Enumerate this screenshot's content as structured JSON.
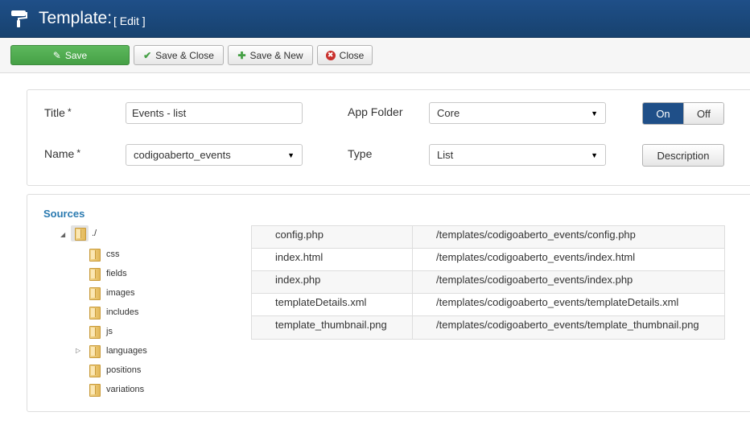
{
  "header": {
    "title": "Template:",
    "subtitle": "[ Edit ]",
    "icon": "paint-roller-icon"
  },
  "toolbar": {
    "save": "Save",
    "save_close": "Save & Close",
    "save_new": "Save & New",
    "close": "Close"
  },
  "form": {
    "title_label": "Title",
    "title_required": "*",
    "title_value": "Events - list",
    "name_label": "Name",
    "name_required": "*",
    "name_value": "codigoaberto_events",
    "app_folder_label": "App Folder",
    "app_folder_value": "Core",
    "type_label": "Type",
    "type_value": "List",
    "toggle_on": "On",
    "toggle_off": "Off",
    "description_button": "Description"
  },
  "sources": {
    "title": "Sources",
    "root": "./",
    "folders": [
      "css",
      "fields",
      "images",
      "includes",
      "js",
      "languages",
      "positions",
      "variations"
    ],
    "files": [
      {
        "name": "config.php",
        "path": "/templates/codigoaberto_events/config.php"
      },
      {
        "name": "index.html",
        "path": "/templates/codigoaberto_events/index.html"
      },
      {
        "name": "index.php",
        "path": "/templates/codigoaberto_events/index.php"
      },
      {
        "name": "templateDetails.xml",
        "path": "/templates/codigoaberto_events/templateDetails.xml"
      },
      {
        "name": "template_thumbnail.png",
        "path": "/templates/codigoaberto_events/template_thumbnail.png"
      }
    ]
  },
  "colors": {
    "header_bg": "#1f4f88",
    "save_green": "#5cb85c",
    "toggle_on": "#1f4f88",
    "sources_title": "#2a7ab0"
  }
}
